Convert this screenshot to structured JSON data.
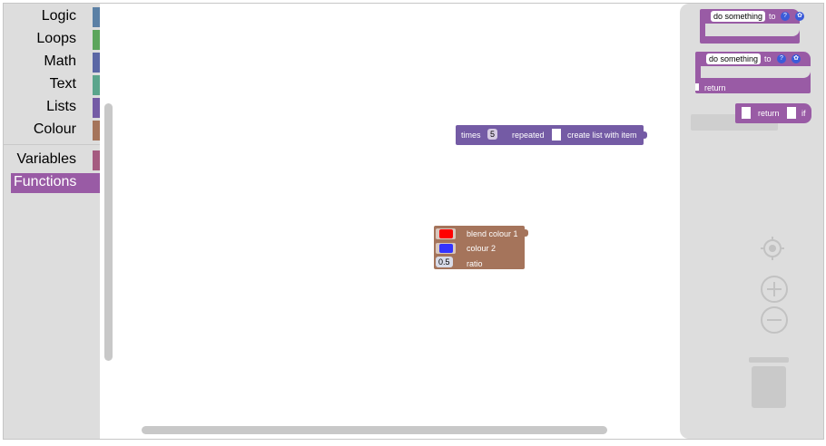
{
  "toolbox": {
    "categories": [
      {
        "label": "Logic",
        "color": "#5b80a5"
      },
      {
        "label": "Loops",
        "color": "#5ba55b"
      },
      {
        "label": "Math",
        "color": "#5b67a5"
      },
      {
        "label": "Text",
        "color": "#5ba58c"
      },
      {
        "label": "Lists",
        "color": "#745ba5"
      },
      {
        "label": "Colour",
        "color": "#a5745b"
      },
      {
        "label": "Variables",
        "color": "#a55b80"
      },
      {
        "label": "Functions",
        "color": "#995ba5",
        "selected": true
      }
    ]
  },
  "workspace": {
    "lists_block": {
      "times_label": "times",
      "times_value": "5",
      "repeated_label": "repeated",
      "create_list_label": "create list with item",
      "color": "#745ba5"
    },
    "colour_block": {
      "blend_label": "blend colour 1",
      "colour2_label": "colour 2",
      "ratio_label": "ratio",
      "colour1_value": "#ff0000",
      "colour2_value": "#3333ff",
      "ratio_value": "0.5",
      "color": "#a5745b"
    }
  },
  "flyout": {
    "proc_noreturn": {
      "name": "do something",
      "to_label": "to",
      "help_icon": "?",
      "gear_icon": "gear-icon"
    },
    "proc_return": {
      "name": "do something",
      "to_label": "to",
      "help_icon": "?",
      "gear_icon": "gear-icon",
      "return_label": "return"
    },
    "if_return": {
      "return_label": "return",
      "if_label": "if"
    },
    "color": "#995ba5"
  },
  "controls": {
    "recenter_icon": "target-icon",
    "zoom_in_icon": "plus-icon",
    "zoom_out_icon": "minus-icon",
    "trash_icon": "trash-icon"
  }
}
